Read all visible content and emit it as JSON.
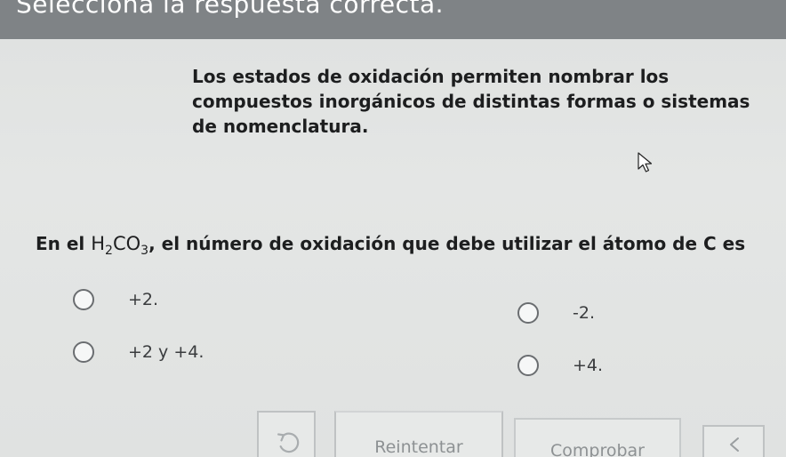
{
  "header": {
    "instruction": "Selecciona la respuesta correcta."
  },
  "intro": {
    "text": "Los estados de oxidación permiten nombrar los compuestos inorgánicos de distintas formas o sistemas de nomenclatura."
  },
  "question": {
    "prefix": "En el ",
    "formula": {
      "h": "H",
      "h_sub": "2",
      "co": "CO",
      "co_sub": "3"
    },
    "suffix": ", el número de oxidación que debe utilizar el átomo de C es"
  },
  "options": [
    {
      "label": "+2."
    },
    {
      "label": "-2."
    },
    {
      "label": "+2 y +4."
    },
    {
      "label": "+4."
    }
  ],
  "buttons": {
    "retry_label": "Reintentar",
    "check_label": "Comprobar"
  },
  "icons": {
    "retry": "undo-arrow-icon",
    "previous": "chevron-left-icon",
    "cursor": "mouse-pointer-icon"
  }
}
